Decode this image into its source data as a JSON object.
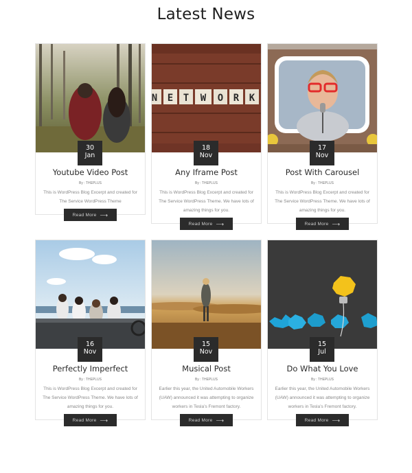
{
  "section": {
    "title": "Latest News"
  },
  "read_more_label": "Read More",
  "posts": [
    {
      "title": "Youtube Video Post",
      "day": "30",
      "month": "Jan",
      "author": "By : THEPLUS",
      "excerpt": "This is WordPress Blog Excerpt and created for The Service WordPress Theme"
    },
    {
      "title": "Any Iframe Post",
      "day": "18",
      "month": "Nov",
      "author": "By : THEPLUS",
      "excerpt": "This is WordPress Blog Excerpt and created for The Service WordPress Theme. We have lots of amazing things for you."
    },
    {
      "title": "Post With Carousel",
      "day": "17",
      "month": "Nov",
      "author": "By : THEPLUS",
      "excerpt": "This is WordPress Blog Excerpt and created for The Service WordPress Theme. We have lots of amazing things for you."
    },
    {
      "title": "Perfectly Imperfect",
      "day": "16",
      "month": "Nov",
      "author": "By : THEPLUS",
      "excerpt": "This is WordPress Blog Excerpt and created for The Service WordPress Theme. We have lots of amazing things for you."
    },
    {
      "title": "Musical Post",
      "day": "15",
      "month": "Nov",
      "author": "By : THEPLUS",
      "excerpt": "Earlier this year, the United Automobile Workers (UAW) announced it was attempting to organize workers in Tesla’s Fremont factory."
    },
    {
      "title": "Do What You Love",
      "day": "15",
      "month": "Jul",
      "author": "By : THEPLUS",
      "excerpt": "Earlier this year, the United Automobile Workers (UAW) announced it was attempting to organize workers in Tesla’s Fremont factory."
    }
  ],
  "network_letters": [
    "N",
    "E",
    "T",
    "W",
    "O",
    "R",
    "K"
  ]
}
